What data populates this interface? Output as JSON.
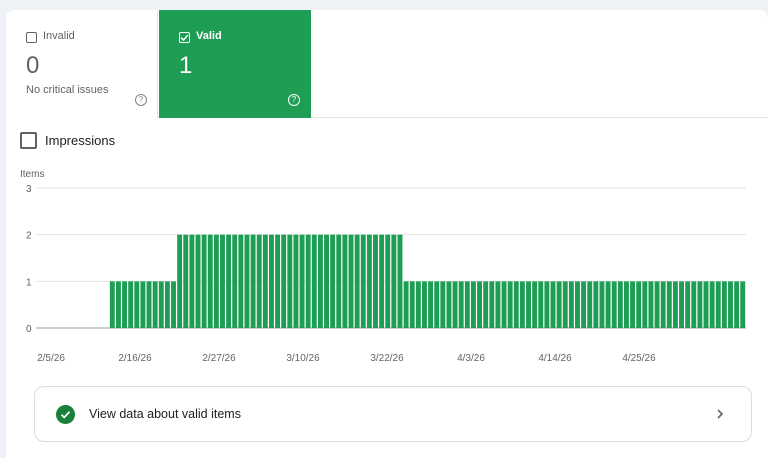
{
  "tiles": {
    "invalid": {
      "label": "Invalid",
      "value": "0",
      "description": "No critical issues",
      "checked": false,
      "help": "?"
    },
    "valid": {
      "label": "Valid",
      "value": "1",
      "checked": true,
      "help": "?",
      "color": "#1e9e54"
    }
  },
  "impressions": {
    "label": "Impressions",
    "checked": false
  },
  "chart_data": {
    "type": "bar",
    "ylabel": "Items",
    "ylim": [
      0,
      3
    ],
    "yticks": [
      0,
      1,
      2,
      3
    ],
    "grid": true,
    "color": "#1e9e54",
    "xtick_labels": [
      "2/5/26",
      "2/16/26",
      "2/27/26",
      "3/10/26",
      "3/22/26",
      "4/3/26",
      "4/14/26",
      "4/25/26"
    ],
    "segments": [
      {
        "value": 0,
        "bars": 12
      },
      {
        "value": 1,
        "bars": 11
      },
      {
        "value": 2,
        "bars": 37
      },
      {
        "value": 1,
        "bars": 56
      }
    ]
  },
  "cta": {
    "label": "View data about valid items",
    "status_color": "#188038"
  }
}
